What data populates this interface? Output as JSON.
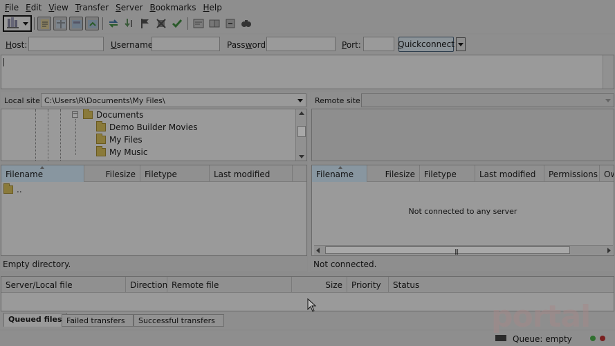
{
  "menu": [
    {
      "label_pre": "",
      "label_u": "F",
      "label_post": "ile"
    },
    {
      "label_pre": "",
      "label_u": "E",
      "label_post": "dit"
    },
    {
      "label_pre": "",
      "label_u": "V",
      "label_post": "iew"
    },
    {
      "label_pre": "",
      "label_u": "T",
      "label_post": "ransfer"
    },
    {
      "label_pre": "",
      "label_u": "S",
      "label_post": "erver"
    },
    {
      "label_pre": "",
      "label_u": "B",
      "label_post": "ookmarks"
    },
    {
      "label_pre": "",
      "label_u": "H",
      "label_post": "elp"
    }
  ],
  "toolbar": {
    "icons": [
      "site-manager-icon",
      "message-log-icon",
      "local-tree-icon",
      "remote-tree-icon",
      "transfer-queue-icon",
      "refresh-icon",
      "process-queue-icon",
      "cancel-icon",
      "disconnect-icon",
      "reconnect-icon",
      "directory-filter-icon",
      "compare-icon",
      "sync-browse-icon",
      "search-icon"
    ]
  },
  "quickconnect": {
    "host_label_u": "H",
    "host_label_post": "ost:",
    "username_label_u": "U",
    "username_label_post": "sername:",
    "password_label_pre": "Pass",
    "password_label_u": "w",
    "password_label_post": "ord:",
    "port_label_u": "P",
    "port_label_post": "ort:",
    "button_u": "Q",
    "button_post": "uickconnect",
    "host_value": "",
    "username_value": "",
    "password_value": "",
    "port_value": ""
  },
  "local_site": {
    "label": "Local site:",
    "path": "C:\\Users\\R\\Documents\\My Files\\",
    "tree": [
      {
        "name": "Documents"
      },
      {
        "name": "Demo Builder Movies"
      },
      {
        "name": "My Files"
      },
      {
        "name": "My Music"
      }
    ]
  },
  "remote_site": {
    "label": "Remote site:",
    "path": ""
  },
  "local_list": {
    "columns": [
      "Filename",
      "Filesize",
      "Filetype",
      "Last modified"
    ],
    "rows": [
      ".."
    ],
    "status": "Empty directory."
  },
  "remote_list": {
    "columns": [
      "Filename",
      "Filesize",
      "Filetype",
      "Last modified",
      "Permissions",
      "Ow"
    ],
    "message": "Not connected to any server",
    "status": "Not connected."
  },
  "queue": {
    "columns": [
      "Server/Local file",
      "Direction",
      "Remote file",
      "Size",
      "Priority",
      "Status"
    ]
  },
  "tabs": [
    "Queued files",
    "Failed transfers",
    "Successful transfers"
  ],
  "status_bar": {
    "queue_text": "Queue: empty",
    "led_colors": [
      "#2f6f2f",
      "#7a2020"
    ]
  },
  "watermark": "portal"
}
